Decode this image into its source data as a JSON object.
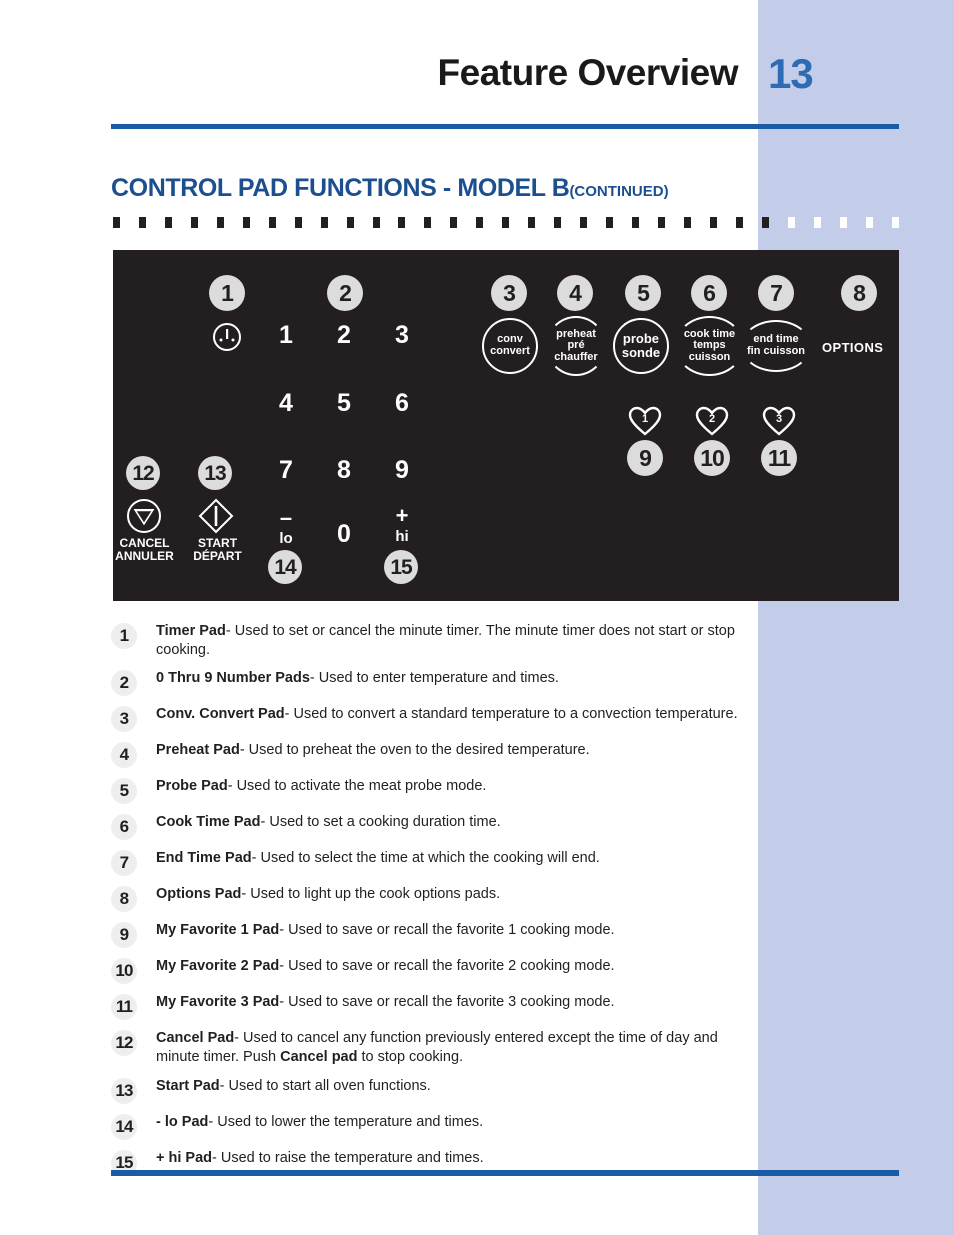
{
  "header": {
    "title": "Feature Overview",
    "page_number": "13",
    "rule_color": "#1a5ba6"
  },
  "section": {
    "heading": "CONTROL PAD FUNCTIONS - MODEL B",
    "heading_suffix": "(CONTINUED)",
    "heading_color": "#1b4f8f"
  },
  "panel": {
    "background": "#231f20",
    "callouts": [
      "1",
      "2",
      "3",
      "4",
      "5",
      "6",
      "7",
      "8",
      "9",
      "10",
      "11",
      "12",
      "13",
      "14",
      "15"
    ],
    "timer_icon": "clock-face-icon",
    "cancel_icon": "triangle-down-icon",
    "start_icon": "diamond-bar-icon",
    "cancel_label_en": "CANCEL",
    "cancel_label_fr": "ANNULER",
    "start_label_en": "START",
    "start_label_fr": "DÉPART",
    "keypad": [
      "1",
      "2",
      "3",
      "4",
      "5",
      "6",
      "7",
      "8",
      "9"
    ],
    "key_zero": "0",
    "key_minus_sign": "–",
    "key_minus_word": "lo",
    "key_plus_sign": "+",
    "key_plus_word": "hi",
    "pads": [
      {
        "name": "conv-convert",
        "line1": "conv",
        "line2": "convert",
        "shape": "circle"
      },
      {
        "name": "preheat",
        "line1": "preheat",
        "line2": "pré",
        "line3": "chauffer",
        "shape": "arc"
      },
      {
        "name": "probe",
        "line1": "probe",
        "line2": "sonde",
        "shape": "circle"
      },
      {
        "name": "cook-time",
        "line1": "cook time",
        "line2": "temps",
        "line3": "cuisson",
        "shape": "arc"
      },
      {
        "name": "end-time",
        "line1": "end time",
        "line2": "fin cuisson",
        "shape": "arc"
      },
      {
        "name": "options",
        "line1": "OPTIONS",
        "shape": "text"
      }
    ],
    "favorites": [
      "1",
      "2",
      "3"
    ]
  },
  "descriptions": [
    {
      "num": "1",
      "title": "Timer Pad",
      "body": "- Used to set or cancel the minute timer. The minute timer does not start or stop cooking."
    },
    {
      "num": "2",
      "title": "0 Thru 9 Number Pads",
      "body": "- Used to enter temperature and times."
    },
    {
      "num": "3",
      "title": "Conv. Convert Pad",
      "body": "- Used to convert a standard temperature to a convection temperature."
    },
    {
      "num": "4",
      "title": "Preheat Pad",
      "body": "- Used to preheat the oven to the desired temperature."
    },
    {
      "num": "5",
      "title": "Probe Pad",
      "body": "- Used to activate the meat probe mode."
    },
    {
      "num": "6",
      "title": "Cook Time Pad",
      "body": "- Used to set a cooking duration time."
    },
    {
      "num": "7",
      "title": "End Time Pad",
      "body": "- Used to select the time at which the cooking will end."
    },
    {
      "num": "8",
      "title": "Options Pad",
      "body": "- Used to light up the cook options pads."
    },
    {
      "num": "9",
      "title": "My Favorite 1 Pad",
      "body": "- Used to save or recall the favorite 1 cooking mode."
    },
    {
      "num": "10",
      "title": "My Favorite 2 Pad",
      "body": "- Used to save or recall the favorite 2 cooking mode."
    },
    {
      "num": "11",
      "title": "My Favorite 3 Pad",
      "body": "- Used to save or recall the favorite 3 cooking mode."
    },
    {
      "num": "12",
      "title": "Cancel Pad",
      "body": "- Used to cancel any function previously entered except the time of day and minute timer. Push ",
      "bold_mid": "Cancel pad",
      "body2": " to stop cooking."
    },
    {
      "num": "13",
      "title": "Start Pad",
      "body": "- Used to start all oven functions."
    },
    {
      "num": "14",
      "title": "- lo Pad",
      "body": "- Used to lower the temperature and times."
    },
    {
      "num": "15",
      "title": "+ hi Pad",
      "body": "- Used to raise the temperature and times."
    }
  ]
}
